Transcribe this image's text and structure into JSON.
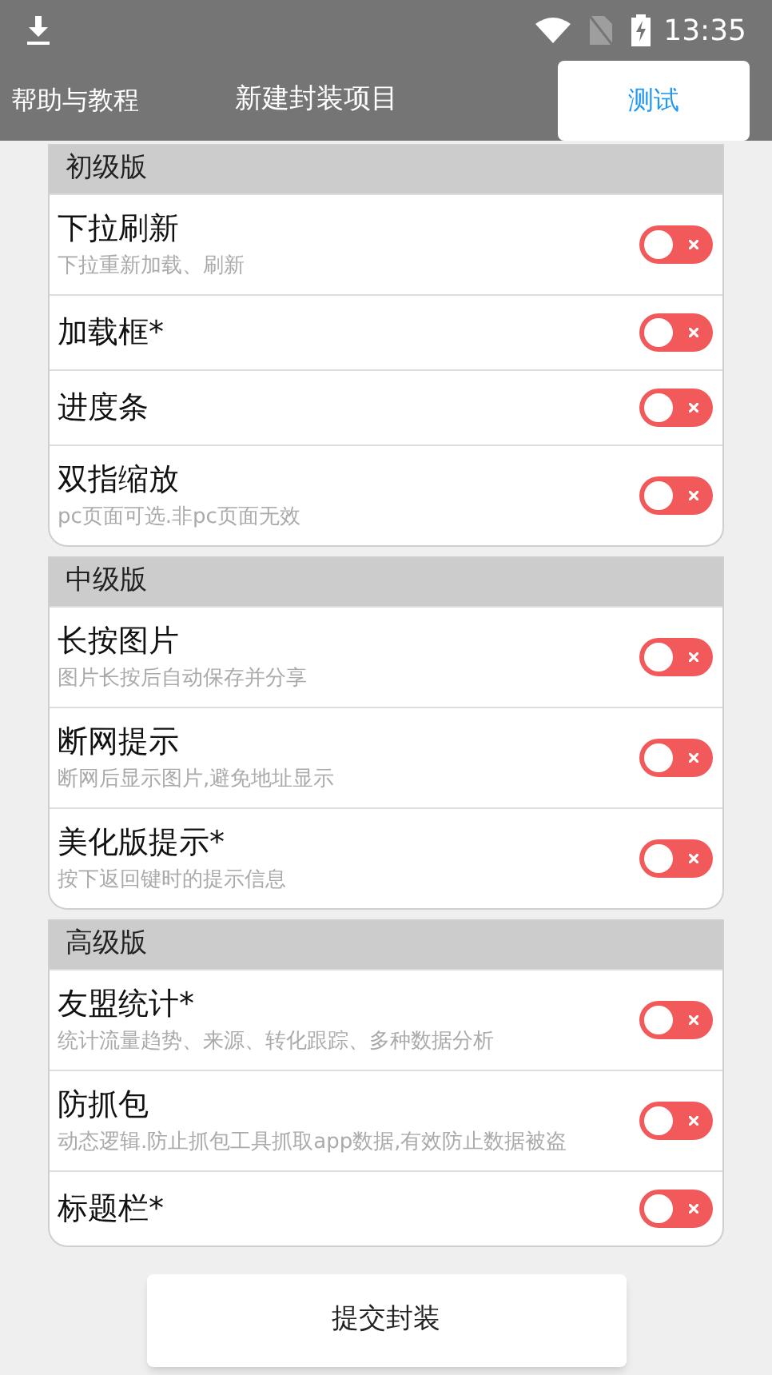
{
  "status_bar": {
    "time": "13:35"
  },
  "app_bar": {
    "left": "帮助与教程",
    "title": "新建封装项目",
    "action": "测试"
  },
  "sections": [
    {
      "title": "初级版",
      "items": [
        {
          "title": "下拉刷新",
          "description": "下拉重新加载、刷新",
          "on": false
        },
        {
          "title": "加载框*",
          "on": false
        },
        {
          "title": "进度条",
          "on": false
        },
        {
          "title": "双指缩放",
          "description": "pc页面可选.非pc页面无效",
          "on": false
        }
      ]
    },
    {
      "title": "中级版",
      "items": [
        {
          "title": "长按图片",
          "description": "图片长按后自动保存并分享",
          "on": false
        },
        {
          "title": "断网提示",
          "description": "断网后显示图片,避免地址显示",
          "on": false
        },
        {
          "title": "美化版提示*",
          "description": "按下返回键时的提示信息",
          "on": false
        }
      ]
    },
    {
      "title": "高级版",
      "items": [
        {
          "title": "友盟统计*",
          "description": "统计流量趋势、来源、转化跟踪、多种数据分析",
          "on": false
        },
        {
          "title": "防抓包",
          "description": "动态逻辑.防止抓包工具抓取app数据,有效防止数据被盗",
          "on": false
        },
        {
          "title": "标题栏*",
          "on": false
        }
      ]
    }
  ],
  "submit": "提交封装"
}
